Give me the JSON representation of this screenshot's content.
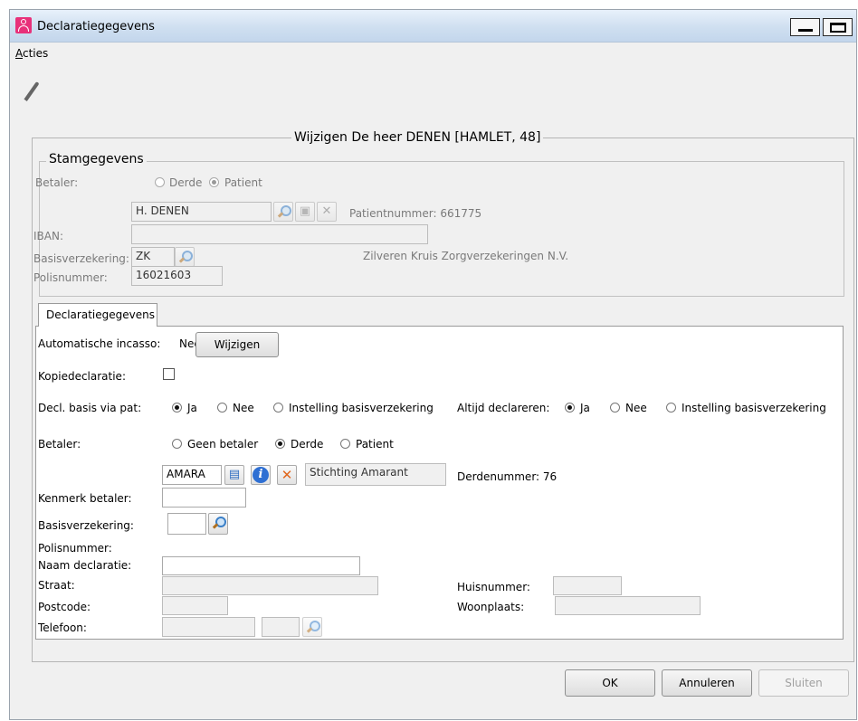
{
  "window": {
    "title": "Declaratiegegevens",
    "menu": "Acties"
  },
  "toolbar": {
    "icons": [
      "pencil-icon"
    ]
  },
  "outer_frame": {
    "title": "Wijzigen De heer DENEN [HAMLET, 48]"
  },
  "stamgegevens": {
    "title": "Stamgegevens",
    "betaler_label": "Betaler:",
    "betaler_options": [
      "Derde",
      "Patient"
    ],
    "betaler_selected": "Patient",
    "name_value": "H. DENEN",
    "patientnummer": "Patientnummer: 661775",
    "iban_label": "IBAN:",
    "iban_value": "",
    "basisverzekering_label": "Basisverzekering:",
    "basisverzekering_code": "ZK",
    "verzekeraar": "Zilveren Kruis Zorgverzekeringen N.V.",
    "polisnummer_label": "Polisnummer:",
    "polisnummer_value": "16021603"
  },
  "tab": {
    "label": "Declaratiegegevens"
  },
  "decl": {
    "incasso_label": "Automatische incasso:",
    "incasso_value": "Nee",
    "wijzigen_label": "Wijzigen",
    "kopie_label": "Kopiedeclaratie:",
    "kopie_checked": false,
    "basis_label": "Decl. basis via pat:",
    "basis_options": [
      "Ja",
      "Nee",
      "Instelling basisverzekering"
    ],
    "basis_selected": "Ja",
    "altijd_label": "Altijd declareren:",
    "altijd_options": [
      "Ja",
      "Nee",
      "Instelling basisverzekering"
    ],
    "altijd_selected": "Ja",
    "betaler_label": "Betaler:",
    "betaler_options": [
      "Geen betaler",
      "Derde",
      "Patient"
    ],
    "betaler_selected": "Derde",
    "derde_code": "AMARA",
    "derde_naam": "Stichting Amarant",
    "derdenummer": "Derdenummer: 76",
    "kenmerk_label": "Kenmerk betaler:",
    "kenmerk_value": "",
    "basisverz_label": "Basisverzekering:",
    "basisverz_value": "",
    "polis_label": "Polisnummer:",
    "naam_label": "Naam declaratie:",
    "naam_value": "",
    "straat_label": "Straat:",
    "straat_value": "",
    "huisnummer_label": "Huisnummer:",
    "huisnummer_value": "",
    "postcode_label": "Postcode:",
    "postcode_value": "",
    "woonplaats_label": "Woonplaats:",
    "woonplaats_value": "",
    "telefoon_label": "Telefoon:",
    "telefoon_value": "",
    "telefoon_ext": ""
  },
  "buttons": {
    "ok": "OK",
    "annuleren": "Annuleren",
    "sluiten": "Sluiten"
  }
}
